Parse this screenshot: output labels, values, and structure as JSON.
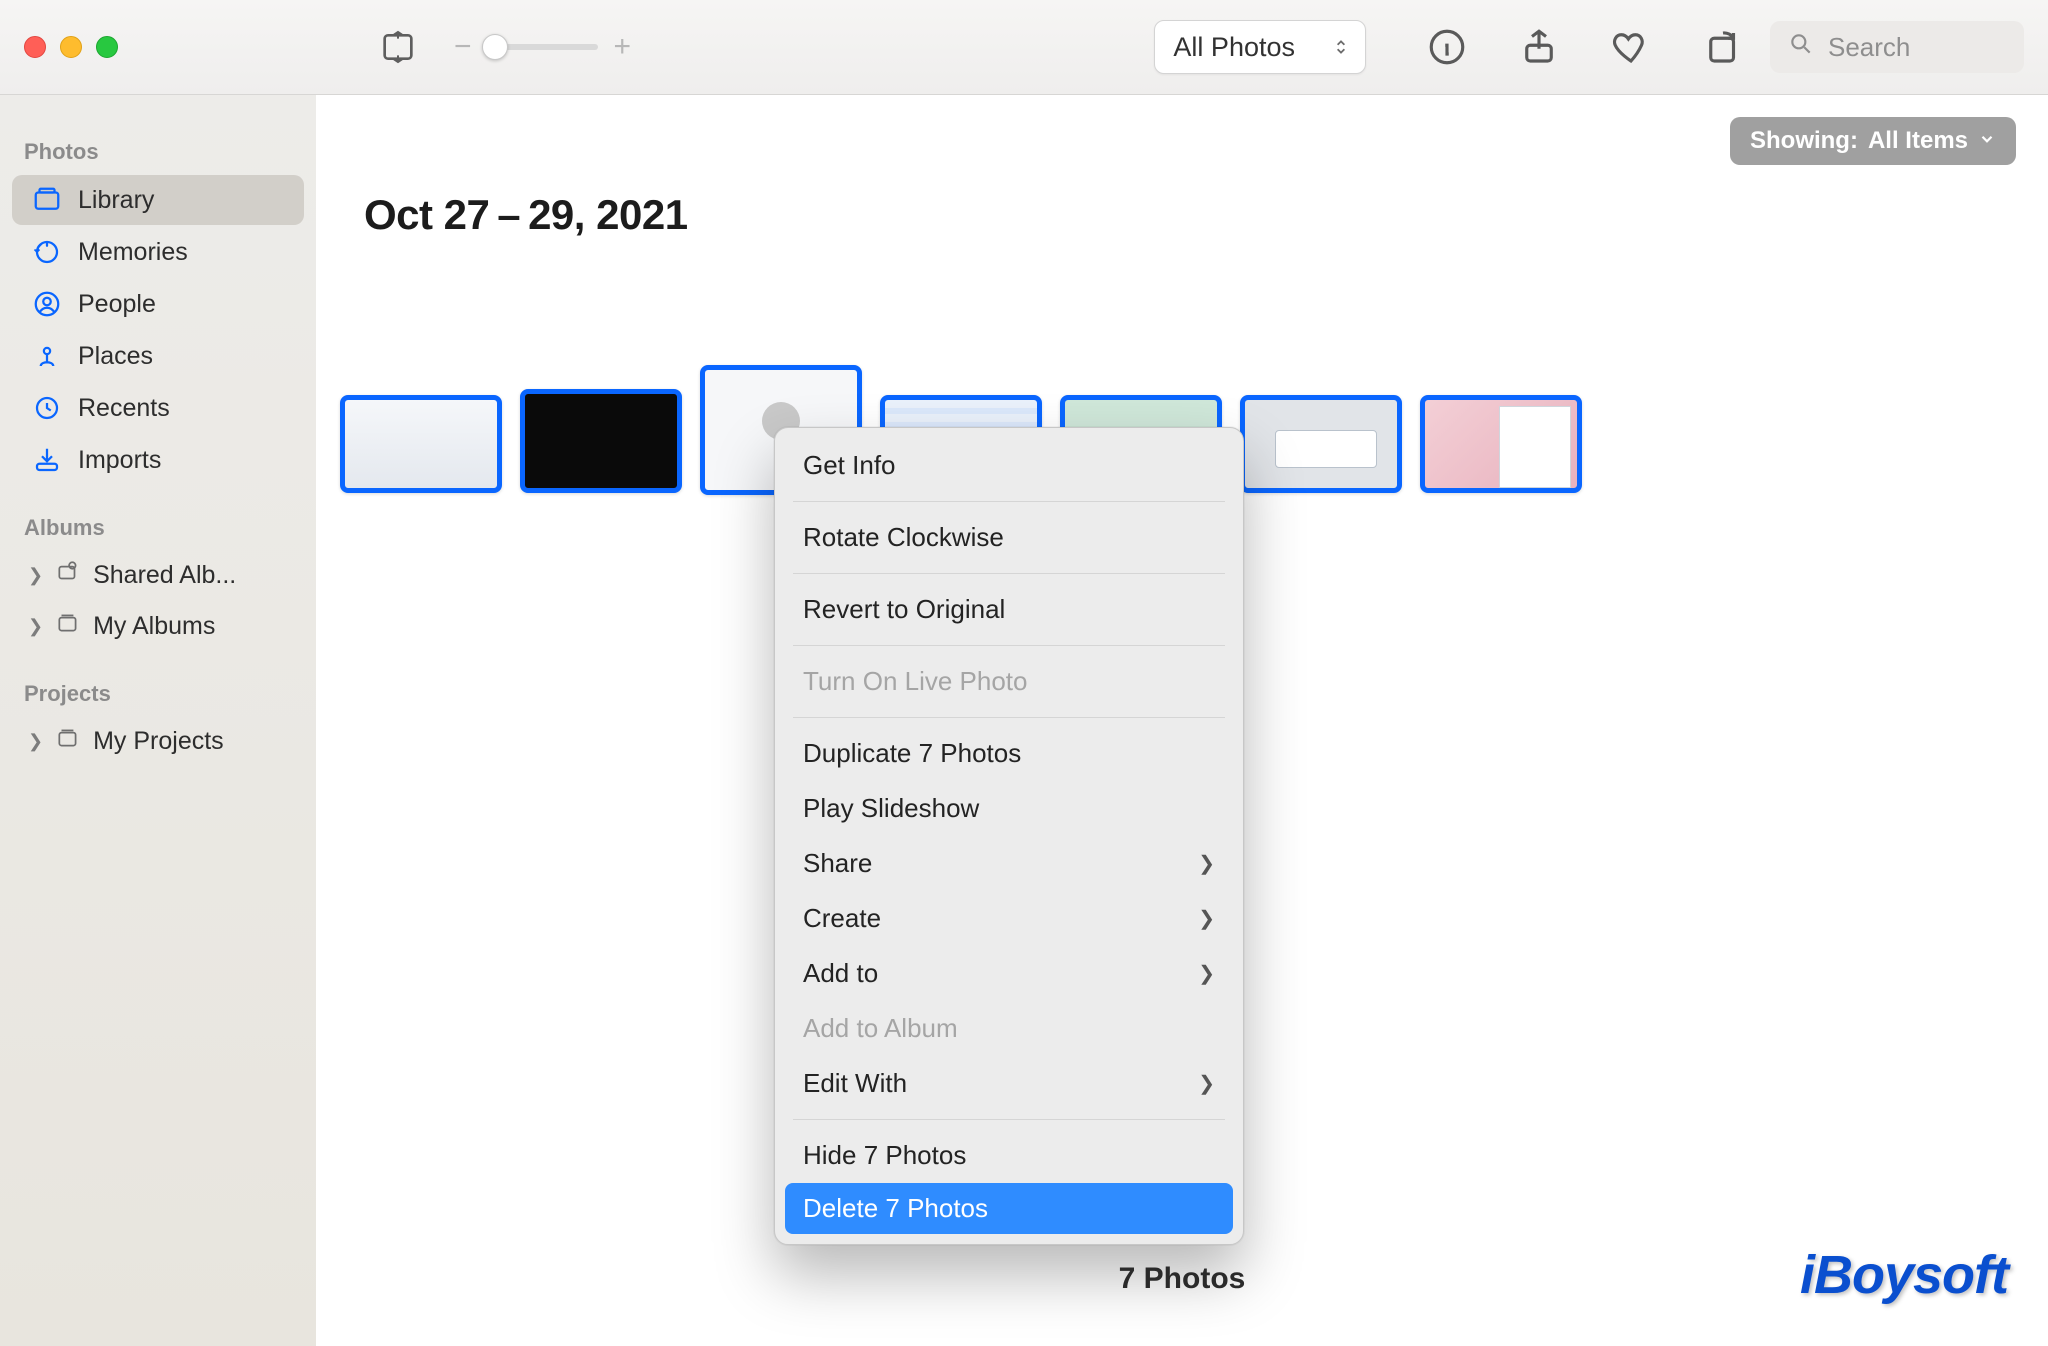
{
  "toolbar": {
    "view_selector": "All Photos",
    "search_placeholder": "Search"
  },
  "showing": {
    "prefix": "Showing:",
    "value": "All Items"
  },
  "sidebar": {
    "section_photos": "Photos",
    "items": [
      {
        "label": "Library"
      },
      {
        "label": "Memories"
      },
      {
        "label": "People"
      },
      {
        "label": "Places"
      },
      {
        "label": "Recents"
      },
      {
        "label": "Imports"
      }
    ],
    "section_albums": "Albums",
    "album_items": [
      {
        "label": "Shared Alb..."
      },
      {
        "label": "My Albums"
      }
    ],
    "section_projects": "Projects",
    "project_items": [
      {
        "label": "My Projects"
      }
    ]
  },
  "header": {
    "date_range": "Oct 27 – 29, 2021"
  },
  "context_menu": {
    "get_info": "Get Info",
    "rotate": "Rotate Clockwise",
    "revert": "Revert to Original",
    "live_photo": "Turn On Live Photo",
    "duplicate": "Duplicate 7 Photos",
    "slideshow": "Play Slideshow",
    "share": "Share",
    "create": "Create",
    "add_to": "Add to",
    "add_to_album": "Add to Album",
    "edit_with": "Edit With",
    "hide": "Hide 7 Photos",
    "delete": "Delete 7 Photos"
  },
  "footer": {
    "count": "7 Photos"
  },
  "watermark": "iBoysoft"
}
